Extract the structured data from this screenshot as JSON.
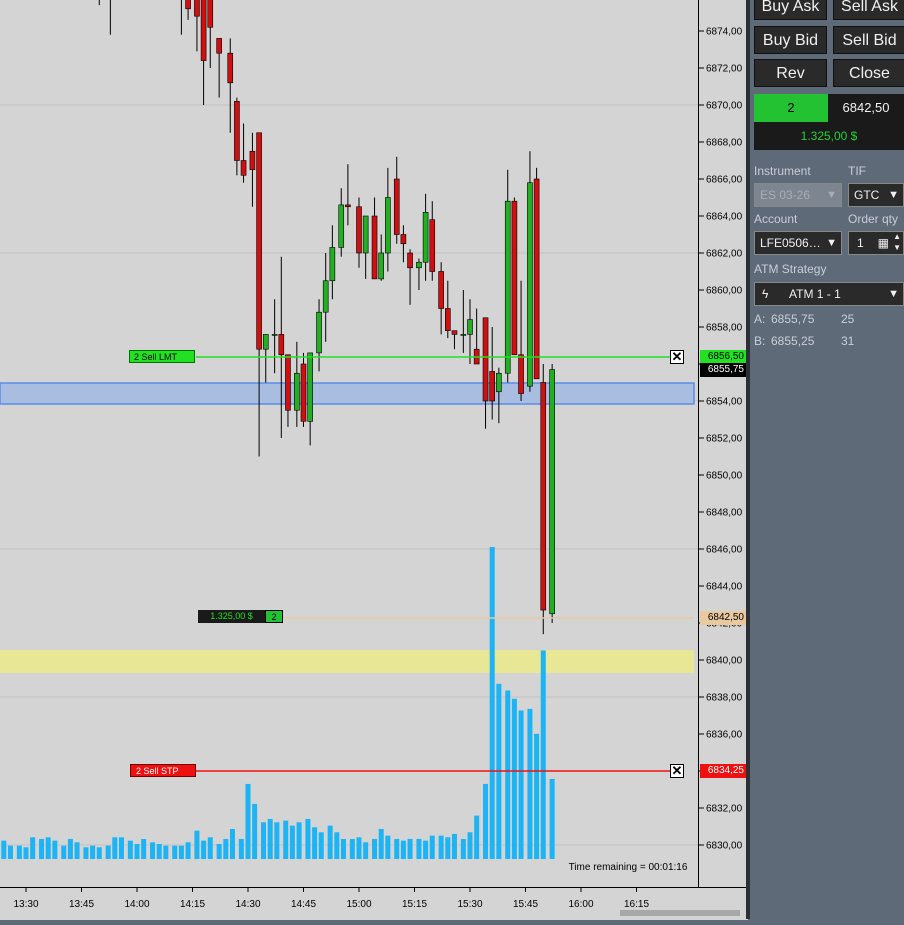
{
  "buttons": {
    "buy_ask": "Buy Ask",
    "sell_ask": "Sell Ask",
    "buy_bid": "Buy Bid",
    "sell_bid": "Sell Bid",
    "rev": "Rev",
    "close": "Close"
  },
  "position": {
    "qty": "2",
    "avg_price": "6842,50",
    "pnl": "1.325,00 $",
    "qty_color": "#22c232",
    "pnl_color": "#22d232"
  },
  "form": {
    "instrument_label": "Instrument",
    "instrument_value": "ES 03-26",
    "tif_label": "TIF",
    "tif_value": "GTC",
    "account_label": "Account",
    "account_value": "LFE0506…",
    "order_qty_label": "Order qty",
    "order_qty_value": "1",
    "atm_label": "ATM Strategy",
    "atm_value": "ATM 1 - 1"
  },
  "ask_bid": {
    "ask_label": "A:",
    "ask_price": "6855,75",
    "ask_size": "25",
    "bid_label": "B:",
    "bid_price": "6855,25",
    "bid_size": "31"
  },
  "orders": {
    "sell_lmt_label": "2  Sell LMT",
    "sell_lmt_price": "6856,50",
    "sell_stp_label": "2  Sell STP",
    "sell_stp_price": "6834,25",
    "position_pnl": "1.325,00 $",
    "position_qty": "2",
    "position_price": "6842,50",
    "last_price": "6855,75",
    "close_icon": "close-x-icon"
  },
  "time_remaining": "Time remaining = 00:01:16",
  "colors": {
    "up": "#22b022",
    "down": "#d01010",
    "volume": "#1cb4f4",
    "limit": "#22e022",
    "stop": "#ee1111",
    "entry": "#e8c9a0",
    "zone_blue": "#a8bde0",
    "zone_yellow": "#eaea8a"
  },
  "chart_data": {
    "type": "candlestick",
    "y_ticks": [
      "6874,00",
      "6872,00",
      "6870,00",
      "6868,00",
      "6866,00",
      "6864,00",
      "6862,00",
      "6860,00",
      "6858,00",
      "6856,00",
      "6854,00",
      "6852,00",
      "6850,00",
      "6848,00",
      "6846,00",
      "6844,00",
      "6842,00",
      "6840,00",
      "6838,00",
      "6836,00",
      "6834,00",
      "6832,00",
      "6830,00"
    ],
    "x_ticks": [
      "13:30",
      "13:45",
      "14:00",
      "14:15",
      "14:30",
      "14:45",
      "15:00",
      "15:15",
      "15:30",
      "15:45",
      "16:00",
      "16:15"
    ],
    "ylim": [
      6829.0,
      6876.5
    ],
    "start_minute": "13:23",
    "candles": [
      {
        "t": 13.83,
        "o": 6876.5,
        "h": 6876.5,
        "l": 6875.4,
        "c": 6876.0
      },
      {
        "t": 13.88,
        "o": 6876.0,
        "h": 6876.5,
        "l": 6873.8,
        "c": 6876.5
      },
      {
        "t": 14.2,
        "o": 6876.5,
        "h": 6876.5,
        "l": 6873.8,
        "c": 6876.1
      },
      {
        "t": 14.23,
        "o": 6876.1,
        "h": 6876.5,
        "l": 6874.6,
        "c": 6875.2
      },
      {
        "t": 14.27,
        "o": 6875.8,
        "h": 6876.5,
        "l": 6872.9,
        "c": 6874.8
      },
      {
        "t": 14.3,
        "o": 6876.5,
        "h": 6876.5,
        "l": 6870.0,
        "c": 6872.4
      },
      {
        "t": 14.33,
        "o": 6876.5,
        "h": 6876.5,
        "l": 6872.0,
        "c": 6874.2
      },
      {
        "t": 14.37,
        "o": 6873.6,
        "h": 6873.6,
        "l": 6870.4,
        "c": 6872.8
      },
      {
        "t": 14.42,
        "o": 6872.8,
        "h": 6873.6,
        "l": 6868.5,
        "c": 6871.2
      },
      {
        "t": 14.45,
        "o": 6870.2,
        "h": 6870.4,
        "l": 6866.2,
        "c": 6867.0
      },
      {
        "t": 14.48,
        "o": 6867.0,
        "h": 6869.0,
        "l": 6865.8,
        "c": 6866.2
      },
      {
        "t": 14.52,
        "o": 6867.5,
        "h": 6868.5,
        "l": 6864.5,
        "c": 6866.5
      },
      {
        "t": 14.55,
        "o": 6868.5,
        "h": 6868.5,
        "l": 6851.0,
        "c": 6856.8
      },
      {
        "t": 14.58,
        "o": 6856.8,
        "h": 6857.6,
        "l": 6855.0,
        "c": 6857.6
      },
      {
        "t": 14.62,
        "o": 6857.6,
        "h": 6859.5,
        "l": 6855.5,
        "c": 6857.6
      },
      {
        "t": 14.65,
        "o": 6857.6,
        "h": 6861.8,
        "l": 6852.0,
        "c": 6856.5
      },
      {
        "t": 14.68,
        "o": 6856.5,
        "h": 6856.5,
        "l": 6852.6,
        "c": 6853.5
      },
      {
        "t": 14.72,
        "o": 6853.5,
        "h": 6857.2,
        "l": 6852.6,
        "c": 6855.5
      },
      {
        "t": 14.75,
        "o": 6856.0,
        "h": 6856.6,
        "l": 6852.6,
        "c": 6852.9
      },
      {
        "t": 14.78,
        "o": 6852.9,
        "h": 6856.6,
        "l": 6851.6,
        "c": 6856.6
      },
      {
        "t": 14.82,
        "o": 6856.6,
        "h": 6859.5,
        "l": 6855.6,
        "c": 6858.8
      },
      {
        "t": 14.85,
        "o": 6858.8,
        "h": 6862.0,
        "l": 6857.2,
        "c": 6860.5
      },
      {
        "t": 14.88,
        "o": 6860.5,
        "h": 6863.5,
        "l": 6859.5,
        "c": 6862.3
      },
      {
        "t": 14.92,
        "o": 6862.3,
        "h": 6865.5,
        "l": 6861.8,
        "c": 6864.6
      },
      {
        "t": 14.95,
        "o": 6864.6,
        "h": 6866.8,
        "l": 6863.5,
        "c": 6864.5
      },
      {
        "t": 15.0,
        "o": 6864.5,
        "h": 6865.0,
        "l": 6861.2,
        "c": 6862.0
      },
      {
        "t": 15.03,
        "o": 6862.0,
        "h": 6864.0,
        "l": 6860.6,
        "c": 6864.0
      },
      {
        "t": 15.07,
        "o": 6864.0,
        "h": 6865.0,
        "l": 6860.6,
        "c": 6860.6
      },
      {
        "t": 15.1,
        "o": 6860.6,
        "h": 6863.0,
        "l": 6860.5,
        "c": 6862.0
      },
      {
        "t": 15.13,
        "o": 6862.0,
        "h": 6866.6,
        "l": 6861.0,
        "c": 6865.0
      },
      {
        "t": 15.17,
        "o": 6866.0,
        "h": 6867.2,
        "l": 6862.5,
        "c": 6863.0
      },
      {
        "t": 15.2,
        "o": 6863.0,
        "h": 6863.5,
        "l": 6861.5,
        "c": 6862.5
      },
      {
        "t": 15.23,
        "o": 6862.0,
        "h": 6862.2,
        "l": 6859.2,
        "c": 6861.2
      },
      {
        "t": 15.27,
        "o": 6861.2,
        "h": 6861.7,
        "l": 6860.0,
        "c": 6861.5
      },
      {
        "t": 15.3,
        "o": 6861.5,
        "h": 6865.2,
        "l": 6860.5,
        "c": 6864.2
      },
      {
        "t": 15.33,
        "o": 6863.8,
        "h": 6864.8,
        "l": 6860.5,
        "c": 6861.0
      },
      {
        "t": 15.37,
        "o": 6861.0,
        "h": 6861.5,
        "l": 6857.6,
        "c": 6859.0
      },
      {
        "t": 15.4,
        "o": 6859.0,
        "h": 6860.5,
        "l": 6857.4,
        "c": 6857.8
      },
      {
        "t": 15.43,
        "o": 6857.8,
        "h": 6857.8,
        "l": 6856.8,
        "c": 6857.6
      },
      {
        "t": 15.47,
        "o": 6857.6,
        "h": 6860.0,
        "l": 6856.6,
        "c": 6857.6
      },
      {
        "t": 15.5,
        "o": 6857.6,
        "h": 6859.5,
        "l": 6856.0,
        "c": 6858.4
      },
      {
        "t": 15.53,
        "o": 6856.8,
        "h": 6859.0,
        "l": 6856.0,
        "c": 6856.0
      },
      {
        "t": 15.57,
        "o": 6858.5,
        "h": 6858.5,
        "l": 6852.5,
        "c": 6854.0
      },
      {
        "t": 15.6,
        "o": 6855.6,
        "h": 6858.0,
        "l": 6853.0,
        "c": 6854.0
      },
      {
        "t": 15.63,
        "o": 6854.5,
        "h": 6855.8,
        "l": 6852.8,
        "c": 6855.5
      },
      {
        "t": 15.67,
        "o": 6855.5,
        "h": 6866.5,
        "l": 6855.0,
        "c": 6864.8
      },
      {
        "t": 15.7,
        "o": 6864.8,
        "h": 6865.0,
        "l": 6860.5,
        "c": 6856.5
      },
      {
        "t": 15.73,
        "o": 6856.5,
        "h": 6860.5,
        "l": 6854.0,
        "c": 6854.4
      },
      {
        "t": 15.77,
        "o": 6854.8,
        "h": 6867.5,
        "l": 6854.5,
        "c": 6865.8
      },
      {
        "t": 15.8,
        "o": 6866.0,
        "h": 6866.6,
        "l": 6855.2,
        "c": 6855.2
      },
      {
        "t": 15.83,
        "o": 6855.0,
        "h": 6856.0,
        "l": 6841.4,
        "c": 6842.7
      },
      {
        "t": 15.87,
        "o": 6842.5,
        "h": 6856.0,
        "l": 6842.0,
        "c": 6855.7
      }
    ],
    "volume": [
      {
        "t": 13.0,
        "v": 5
      },
      {
        "t": 13.03,
        "v": 4
      },
      {
        "t": 13.07,
        "v": 4
      },
      {
        "t": 13.1,
        "v": 4
      },
      {
        "t": 13.13,
        "v": 5
      },
      {
        "t": 13.17,
        "v": 4
      },
      {
        "t": 13.2,
        "v": 5
      },
      {
        "t": 13.23,
        "v": 8
      },
      {
        "t": 13.27,
        "v": 11
      },
      {
        "t": 13.3,
        "v": 5
      },
      {
        "t": 13.33,
        "v": 6
      },
      {
        "t": 13.37,
        "v": 7
      },
      {
        "t": 13.4,
        "v": 11
      },
      {
        "t": 13.43,
        "v": 8
      },
      {
        "t": 13.47,
        "v": 8
      },
      {
        "t": 13.5,
        "v": 7
      },
      {
        "t": 13.53,
        "v": 13
      },
      {
        "t": 13.57,
        "v": 12
      },
      {
        "t": 13.6,
        "v": 13
      },
      {
        "t": 13.63,
        "v": 11
      },
      {
        "t": 13.67,
        "v": 8
      },
      {
        "t": 13.7,
        "v": 12
      },
      {
        "t": 13.73,
        "v": 10
      },
      {
        "t": 13.77,
        "v": 7
      },
      {
        "t": 13.8,
        "v": 8
      },
      {
        "t": 13.83,
        "v": 7
      },
      {
        "t": 13.87,
        "v": 8
      },
      {
        "t": 13.9,
        "v": 13
      },
      {
        "t": 13.93,
        "v": 13
      },
      {
        "t": 13.97,
        "v": 11
      },
      {
        "t": 14.0,
        "v": 9
      },
      {
        "t": 14.03,
        "v": 12
      },
      {
        "t": 14.07,
        "v": 10
      },
      {
        "t": 14.1,
        "v": 9
      },
      {
        "t": 14.13,
        "v": 8
      },
      {
        "t": 14.17,
        "v": 8
      },
      {
        "t": 14.2,
        "v": 8
      },
      {
        "t": 14.23,
        "v": 10
      },
      {
        "t": 14.27,
        "v": 17
      },
      {
        "t": 14.3,
        "v": 11
      },
      {
        "t": 14.33,
        "v": 13
      },
      {
        "t": 14.37,
        "v": 9
      },
      {
        "t": 14.4,
        "v": 12
      },
      {
        "t": 14.43,
        "v": 18
      },
      {
        "t": 14.47,
        "v": 12
      },
      {
        "t": 14.5,
        "v": 45
      },
      {
        "t": 14.53,
        "v": 33
      },
      {
        "t": 14.57,
        "v": 22
      },
      {
        "t": 14.6,
        "v": 24
      },
      {
        "t": 14.63,
        "v": 22
      },
      {
        "t": 14.67,
        "v": 23
      },
      {
        "t": 14.7,
        "v": 20
      },
      {
        "t": 14.73,
        "v": 22
      },
      {
        "t": 14.77,
        "v": 24
      },
      {
        "t": 14.8,
        "v": 19
      },
      {
        "t": 14.83,
        "v": 16
      },
      {
        "t": 14.87,
        "v": 20
      },
      {
        "t": 14.9,
        "v": 16
      },
      {
        "t": 14.93,
        "v": 12
      },
      {
        "t": 14.97,
        "v": 12
      },
      {
        "t": 15.0,
        "v": 13
      },
      {
        "t": 15.03,
        "v": 10
      },
      {
        "t": 15.07,
        "v": 12
      },
      {
        "t": 15.1,
        "v": 18
      },
      {
        "t": 15.13,
        "v": 14
      },
      {
        "t": 15.17,
        "v": 12
      },
      {
        "t": 15.2,
        "v": 11
      },
      {
        "t": 15.23,
        "v": 12
      },
      {
        "t": 15.27,
        "v": 12
      },
      {
        "t": 15.3,
        "v": 11
      },
      {
        "t": 15.33,
        "v": 14
      },
      {
        "t": 15.37,
        "v": 14
      },
      {
        "t": 15.4,
        "v": 13
      },
      {
        "t": 15.43,
        "v": 15
      },
      {
        "t": 15.47,
        "v": 12
      },
      {
        "t": 15.5,
        "v": 16
      },
      {
        "t": 15.53,
        "v": 26
      },
      {
        "t": 15.57,
        "v": 45
      },
      {
        "t": 15.6,
        "v": 187
      },
      {
        "t": 15.63,
        "v": 105
      },
      {
        "t": 15.67,
        "v": 101
      },
      {
        "t": 15.7,
        "v": 96
      },
      {
        "t": 15.73,
        "v": 89
      },
      {
        "t": 15.77,
        "v": 90
      },
      {
        "t": 15.8,
        "v": 75
      },
      {
        "t": 15.83,
        "v": 125
      },
      {
        "t": 15.87,
        "v": 48
      }
    ]
  }
}
